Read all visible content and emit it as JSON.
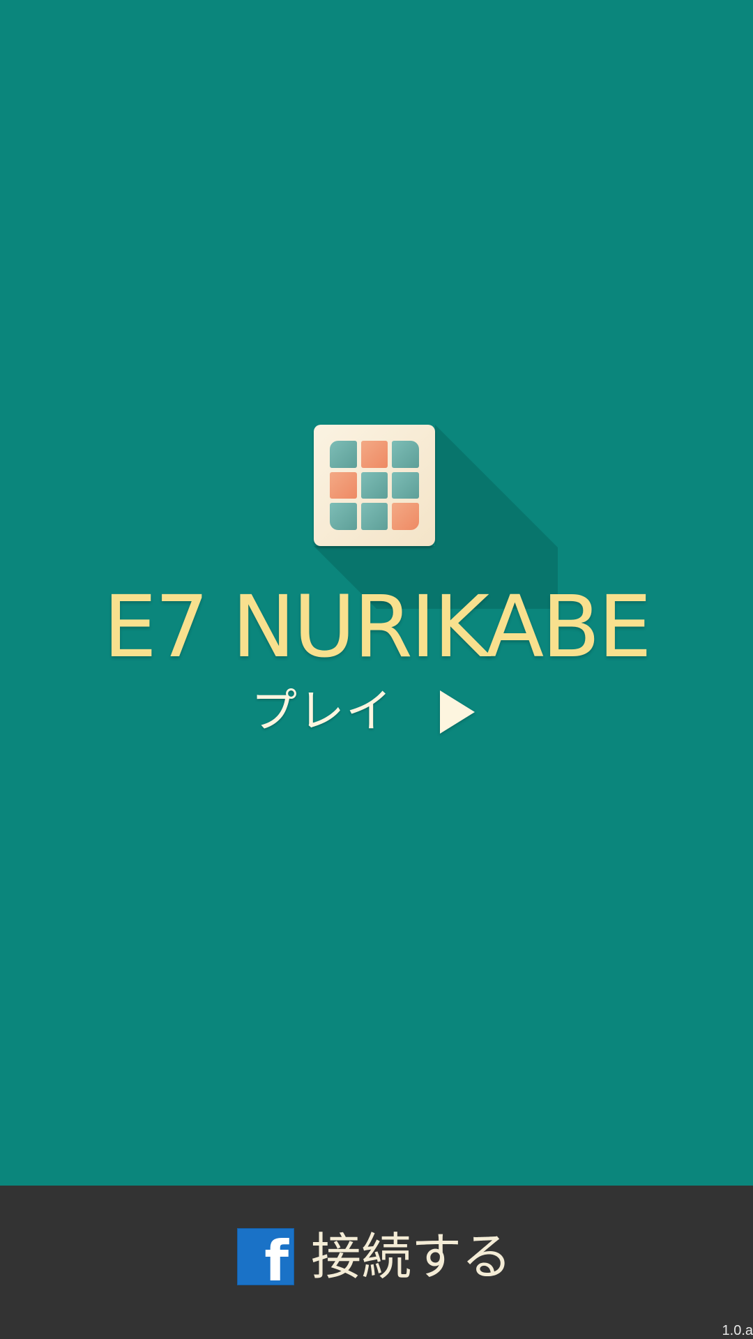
{
  "app": {
    "title": "E7 NURIKABE"
  },
  "logo": {
    "icon": "nurikabe-grid-icon",
    "grid": [
      "teal",
      "orange",
      "teal",
      "orange",
      "teal",
      "teal",
      "teal",
      "teal",
      "orange"
    ]
  },
  "menu": {
    "play_label": "プレイ",
    "play_icon": "play-triangle-icon"
  },
  "footer": {
    "connect_label": "接続する",
    "connect_icon": "facebook-icon",
    "facebook_letter": "f",
    "version": "1.0.a"
  },
  "colors": {
    "background": "#0b867c",
    "title": "#f8e08e",
    "play_text": "#fdf5df",
    "footer_bar": "#333333",
    "facebook_blue": "#1a72c7",
    "tile_teal": "#6fb0a9",
    "tile_orange": "#f09a74"
  }
}
